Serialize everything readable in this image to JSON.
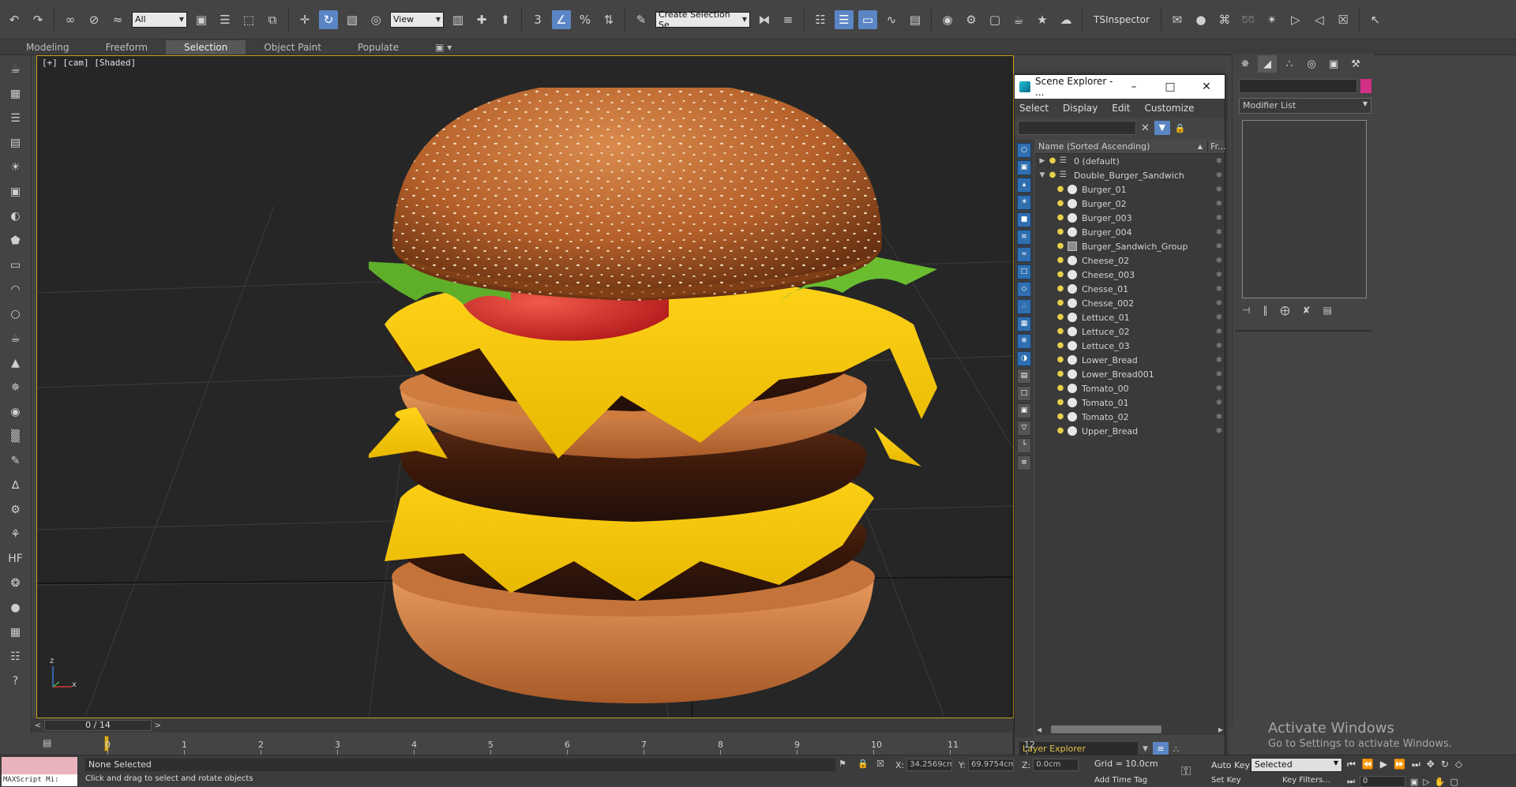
{
  "toolbar": {
    "selection_filter": "All",
    "ref_coord": "View",
    "named_selection_placeholder": "Create Selection Se",
    "tsinspector": "TSInspector",
    "snap_label": "3"
  },
  "ribbon": {
    "tabs": [
      "Modeling",
      "Freeform",
      "Selection",
      "Object Paint",
      "Populate"
    ],
    "active": "Selection"
  },
  "viewport": {
    "label": "[+] [cam] [Shaded]",
    "axis_z": "z",
    "axis_x": "x"
  },
  "timeslider": {
    "frame": "0 / 14",
    "prev": "<",
    "next": ">"
  },
  "ruler": {
    "labels": [
      "0",
      "1",
      "2",
      "3",
      "4",
      "5",
      "6",
      "7",
      "8",
      "9",
      "10",
      "11",
      "12"
    ]
  },
  "scene_explorer": {
    "title": "Scene Explorer - ...",
    "menu": [
      "Select",
      "Display",
      "Edit",
      "Customize"
    ],
    "column_name": "Name (Sorted Ascending)",
    "column_fr": "Fr...",
    "rows": [
      {
        "name": "0 (default)",
        "kind": "layer"
      },
      {
        "name": "Double_Burger_Sandwich",
        "kind": "layer-open"
      },
      {
        "name": "Burger_01",
        "kind": "object"
      },
      {
        "name": "Burger_02",
        "kind": "object"
      },
      {
        "name": "Burger_003",
        "kind": "object"
      },
      {
        "name": "Burger_004",
        "kind": "object"
      },
      {
        "name": "Burger_Sandwich_Group",
        "kind": "group"
      },
      {
        "name": "Cheese_02",
        "kind": "object"
      },
      {
        "name": "Cheese_003",
        "kind": "object"
      },
      {
        "name": "Chesse_01",
        "kind": "object"
      },
      {
        "name": "Chesse_002",
        "kind": "object"
      },
      {
        "name": "Lettuce_01",
        "kind": "object"
      },
      {
        "name": "Lettuce_02",
        "kind": "object"
      },
      {
        "name": "Lettuce_03",
        "kind": "object"
      },
      {
        "name": "Lower_Bread",
        "kind": "object"
      },
      {
        "name": "Lower_Bread001",
        "kind": "object"
      },
      {
        "name": "Tomato_00",
        "kind": "object"
      },
      {
        "name": "Tomato_01",
        "kind": "object"
      },
      {
        "name": "Tomato_02",
        "kind": "object"
      },
      {
        "name": "Upper_Bread",
        "kind": "object"
      }
    ],
    "footer_label": "Layer Explorer"
  },
  "command_panel": {
    "modifier_list": "Modifier List",
    "color": "#d22f87"
  },
  "status": {
    "selection": "None Selected",
    "prompt": "Click and drag to select and rotate objects",
    "x_value": "34.2569cm",
    "y_value": "69.9754cm",
    "z_value": "0.0cm",
    "x_label": "X:",
    "y_label": "Y:",
    "z_label": "Z:",
    "grid": "Grid = 10.0cm",
    "add_time_tag": "Add Time Tag",
    "auto_key": "Auto Key",
    "set_key": "Set Key",
    "key_mode": "Selected",
    "key_filters": "Key Filters...",
    "current_frame": "0",
    "maxscript": "MAXScript Mi:"
  },
  "watermark": {
    "line1": "Activate Windows",
    "line2": "Go to Settings to activate Windows."
  }
}
